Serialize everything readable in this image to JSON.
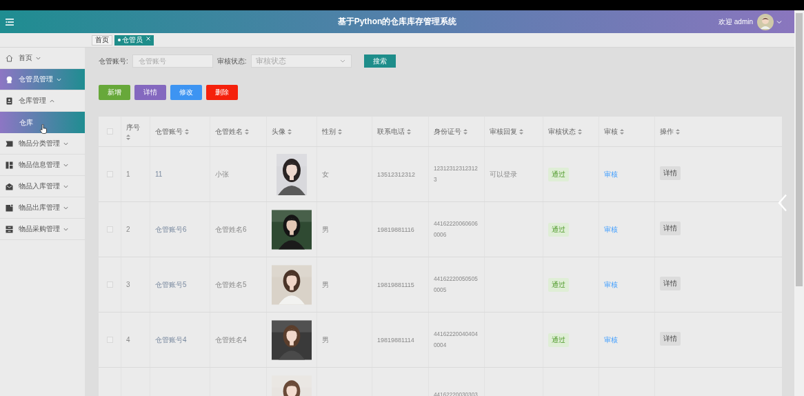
{
  "header": {
    "title": "基于Python的仓库库存管理系统",
    "welcome": "欢迎 admin"
  },
  "tabs": [
    {
      "label": "首页",
      "selected": false,
      "closable": false
    },
    {
      "label": "仓管员",
      "selected": true,
      "closable": true
    }
  ],
  "sidebar": {
    "items": [
      {
        "label": "首页",
        "selected": false,
        "expanded": false
      },
      {
        "label": "仓管员管理",
        "selected": true,
        "expanded": false
      },
      {
        "label": "仓库管理",
        "selected": false,
        "expanded": true,
        "children": [
          {
            "label": "仓库",
            "selected": true
          }
        ]
      },
      {
        "label": "物品分类管理",
        "selected": false,
        "expanded": false
      },
      {
        "label": "物品信息管理",
        "selected": false,
        "expanded": false
      },
      {
        "label": "物品入库管理",
        "selected": false,
        "expanded": false
      },
      {
        "label": "物品出库管理",
        "selected": false,
        "expanded": false
      },
      {
        "label": "物品采购管理",
        "selected": false,
        "expanded": false
      }
    ]
  },
  "search": {
    "fields": [
      {
        "kind": "input",
        "label": "仓管账号:",
        "placeholder": "仓管账号"
      },
      {
        "kind": "select",
        "label": "审核状态:",
        "placeholder": "审核状态"
      }
    ],
    "button": "搜索"
  },
  "actions": [
    {
      "label": "新增",
      "color": "#67a83a"
    },
    {
      "label": "详情",
      "color": "#8468bf"
    },
    {
      "label": "修改",
      "color": "#3d94f2"
    },
    {
      "label": "删除",
      "color": "#f5210c"
    }
  ],
  "table": {
    "columns": [
      "序号",
      "仓管账号",
      "仓管姓名",
      "头像",
      "性别",
      "联系电话",
      "身份证号",
      "审核回复",
      "审核状态",
      "审核",
      "操作"
    ],
    "rows": [
      {
        "checked": false,
        "index": "1",
        "account": "11",
        "name": "小张",
        "gender": "女",
        "phone": "13512312312",
        "id_number": "123123123123123",
        "reply": "可以登录",
        "status": "通过",
        "review": "审核",
        "operation": "详情"
      },
      {
        "checked": false,
        "index": "2",
        "account": "仓管账号6",
        "name": "仓管姓名6",
        "gender": "男",
        "phone": "19819881116",
        "id_number": "441622200606060006",
        "status": "通过",
        "review": "审核",
        "operation": "详情"
      },
      {
        "checked": false,
        "index": "3",
        "account": "仓管账号5",
        "name": "仓管姓名5",
        "gender": "男",
        "phone": "19819881115",
        "id_number": "441622200505050005",
        "status": "通过",
        "review": "审核",
        "operation": "详情"
      },
      {
        "checked": false,
        "index": "4",
        "account": "仓管账号4",
        "name": "仓管姓名4",
        "gender": "男",
        "phone": "19819881114",
        "id_number": "441622200404040004",
        "status": "通过",
        "review": "审核",
        "operation": "详情"
      },
      {
        "id_number": "44162220030303"
      }
    ],
    "select_all": {
      "checked": false
    }
  }
}
